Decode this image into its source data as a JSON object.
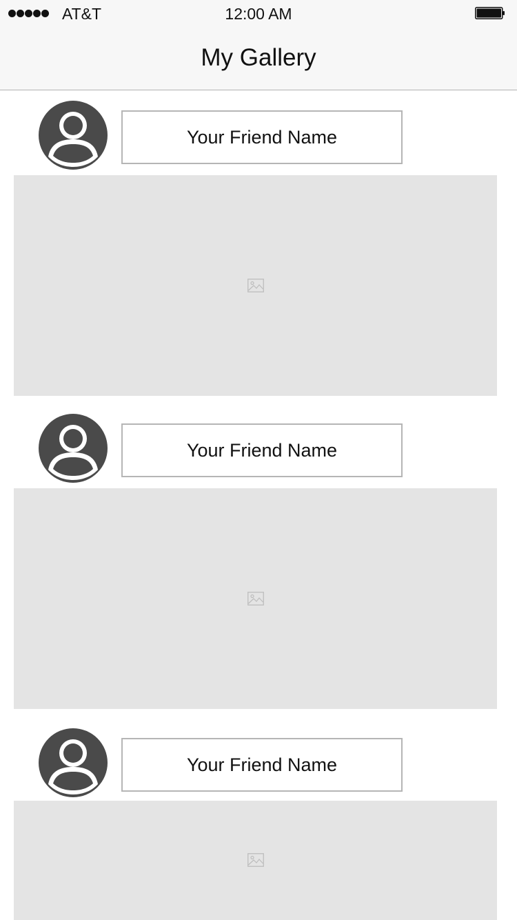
{
  "status_bar": {
    "carrier": "AT&T",
    "time": "12:00 AM",
    "signal_icon": "signal-dots-icon",
    "battery_icon": "battery-full-icon"
  },
  "nav": {
    "title": "My Gallery"
  },
  "posts": [
    {
      "friend_name": "Your Friend Name",
      "avatar_icon": "user-avatar-icon",
      "image_icon": "image-placeholder-icon"
    },
    {
      "friend_name": "Your Friend Name",
      "avatar_icon": "user-avatar-icon",
      "image_icon": "image-placeholder-icon"
    },
    {
      "friend_name": "Your Friend Name",
      "avatar_icon": "user-avatar-icon",
      "image_icon": "image-placeholder-icon"
    }
  ],
  "colors": {
    "header_bg": "#f7f7f7",
    "avatar": "#4a4a4a",
    "photo_placeholder": "#e4e4e4",
    "name_box_border": "#b5b5b5"
  }
}
